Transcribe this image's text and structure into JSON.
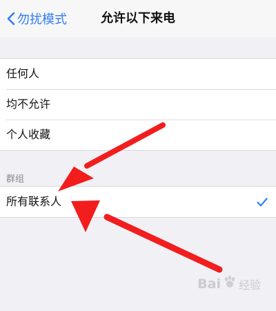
{
  "navbar": {
    "back_label": "勿扰模式",
    "title": "允许以下来电"
  },
  "options": [
    {
      "label": "任何人"
    },
    {
      "label": "均不允许"
    },
    {
      "label": "个人收藏"
    }
  ],
  "groups": {
    "header": "群组",
    "items": [
      {
        "label": "所有联系人",
        "selected": true
      }
    ]
  },
  "watermark": {
    "brand_left": "Bai",
    "brand_right": "经验"
  },
  "colors": {
    "accent": "#2f7cf6",
    "arrow": "#f21d1d"
  },
  "icons": {
    "back": "chevron-left-icon",
    "selected": "checkmark-icon",
    "watermark_logo": "baidu-paw-icon"
  }
}
